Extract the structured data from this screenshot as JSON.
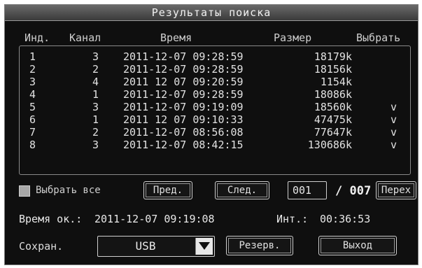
{
  "window": {
    "title": "Результаты поиска"
  },
  "table": {
    "headers": {
      "index": "Инд.",
      "channel": "Канал",
      "time": "Время",
      "size": "Размер",
      "select": "Выбрать"
    },
    "rows": [
      {
        "index": "1",
        "channel": "3",
        "time": "2011-12-07 09:28:59",
        "size": "18179k",
        "selected": ""
      },
      {
        "index": "2",
        "channel": "2",
        "time": "2011-12-07 09:28:59",
        "size": "18156k",
        "selected": ""
      },
      {
        "index": "3",
        "channel": "4",
        "time": "2011 12 07 09:20:59",
        "size": "1154k",
        "selected": ""
      },
      {
        "index": "4",
        "channel": "1",
        "time": "2011-12-07 09:28:59",
        "size": "18086k",
        "selected": ""
      },
      {
        "index": "5",
        "channel": "3",
        "time": "2011-12-07 09:19:09",
        "size": "18560k",
        "selected": "v"
      },
      {
        "index": "6",
        "channel": "1",
        "time": "2011 12 07 09:10:33",
        "size": "47475k",
        "selected": "v"
      },
      {
        "index": "7",
        "channel": "2",
        "time": "2011-12-07 08:56:08",
        "size": "77647k",
        "selected": "v"
      },
      {
        "index": "8",
        "channel": "3",
        "time": "2011-12-07 08:42:15",
        "size": "130686k",
        "selected": "v"
      }
    ]
  },
  "paging": {
    "select_all_label": "Выбрать все",
    "select_all_checked": false,
    "prev_label": "Пред.",
    "next_label": "След.",
    "page_value": "001",
    "total_pages": "/ 007",
    "goto_label": "Перех"
  },
  "info": {
    "total_time_label": "Время ок.:",
    "total_time_value": "2011-12-07 09:19:08",
    "interval_label": "Инт.:",
    "interval_value": "00:36:53"
  },
  "save": {
    "label": "Сохран.",
    "device_value": "USB",
    "backup_label": "Резерв.",
    "exit_label": "Выход"
  },
  "colors": {
    "background": "#0f0f0f",
    "title_bar": "#4a4a4a",
    "text": "#e6e6e6",
    "border": "#cfcfcf"
  }
}
